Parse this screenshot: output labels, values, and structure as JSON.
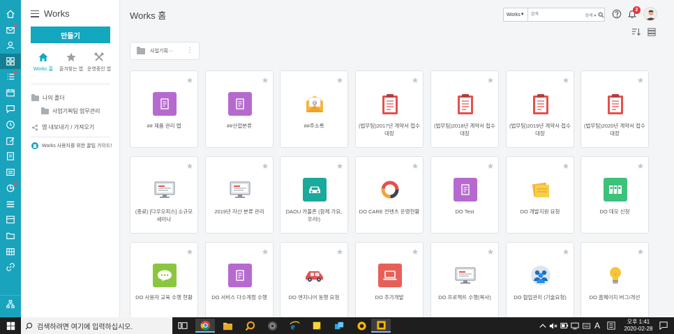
{
  "sidebar": {
    "title": "Works",
    "make_button": "만들기",
    "tabs": [
      {
        "label": "Works 홈"
      },
      {
        "label": "즐겨찾는 앱"
      },
      {
        "label": "운영중인 앱"
      }
    ],
    "my_folder": "나의 폴더",
    "subfolder": "사업기획팀 업무관리",
    "app_import_export": "앱 내보내기 / 가져오기",
    "guide_link": "Works 사용자를 위한 꿀팁 가이드!"
  },
  "header": {
    "page_title": "Works 홈",
    "search_scope": "Works",
    "search_placeholder": "검색",
    "search_detail": "상세",
    "notification_count": "2"
  },
  "folder_card": {
    "label": "사업기획···"
  },
  "apps": [
    {
      "label": "## 제품 관리 앱",
      "icon": "doc-purple-icon"
    },
    {
      "label": "##산업분류",
      "icon": "doc-purple-icon"
    },
    {
      "label": "##주소록",
      "icon": "mail-icon"
    },
    {
      "label": "(법무팀)2017년 계약서 접수 대장",
      "icon": "clipboard-icon"
    },
    {
      "label": "(법무팀)2018년 계약서 접수 대장",
      "icon": "clipboard-icon"
    },
    {
      "label": "(법무팀)2019년 계약서 접수 대장",
      "icon": "clipboard-icon"
    },
    {
      "label": "(법무팀)2020년 계약서 접수 대장",
      "icon": "clipboard-icon"
    },
    {
      "label": "(종료) [다우오피스] 소규모 세미나",
      "icon": "monitor-icon"
    },
    {
      "label": "2019년 자산 분류 관리",
      "icon": "monitor-icon"
    },
    {
      "label": "DAOU 카풀존 (함께 가요, 우리!)",
      "icon": "car-teal-icon"
    },
    {
      "label": "DO CARE 컨텐츠 운영현황",
      "icon": "donut-icon"
    },
    {
      "label": "DO Test",
      "icon": "doc-purple-icon"
    },
    {
      "label": "DO 개발지원 요청",
      "icon": "notes-icon"
    },
    {
      "label": "DO 데모 신청",
      "icon": "film-green-icon"
    },
    {
      "label": "DO 사용자 교육 수행 현황",
      "icon": "chat-green-icon"
    },
    {
      "label": "DO 서비스 다수계정 수행",
      "icon": "doc-purple-icon"
    },
    {
      "label": "DO 엔지니어 동행 요청",
      "icon": "car-red-icon"
    },
    {
      "label": "DO 추가개발",
      "icon": "laptop-red-icon"
    },
    {
      "label": "DO 프로젝트 수행(복사)",
      "icon": "monitor-icon"
    },
    {
      "label": "DO 협업관리 (기술요청)",
      "icon": "people-icon"
    },
    {
      "label": "DO 홈페이지 버그/개선",
      "icon": "bulb-icon"
    }
  ],
  "taskbar": {
    "search_placeholder": "검색하려면 여기에 입력하십시오.",
    "ime": "A",
    "time": "오후 1:41",
    "date": "2020-02-28"
  },
  "colors": {
    "rail": "#19a3bd",
    "accent": "#14a7c0",
    "purple": "#b66ad0",
    "clipboard_red": "#e2514e",
    "teal": "#1aa99a",
    "green": "#3cc27a",
    "badge": "#e8333a"
  }
}
